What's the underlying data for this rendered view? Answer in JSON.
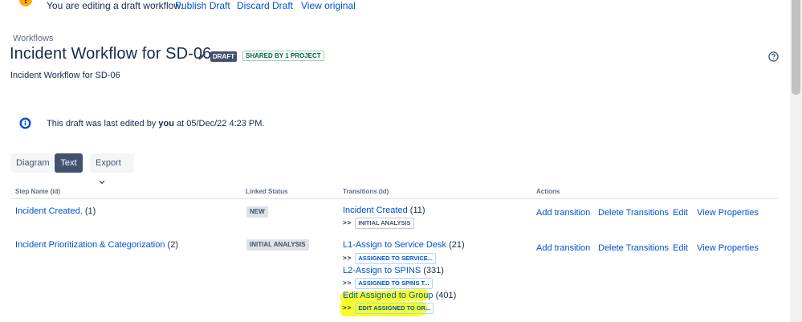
{
  "banner": {
    "icon": "warning-icon",
    "message": "You are editing a draft workflow.",
    "publish_label": "Publish Draft",
    "discard_label": "Discard Draft",
    "view_original_label": "View original"
  },
  "header": {
    "breadcrumb": "Workflows",
    "title": "Incident Workflow for SD-06",
    "draft_lozenge": "DRAFT",
    "shared_lozenge": "SHARED BY 1 PROJECT",
    "subtitle": "Incident Workflow for SD-06"
  },
  "info": {
    "prefix": "This draft was last edited by ",
    "user": "you",
    "suffix": " at 05/Dec/22 4:23 PM."
  },
  "view_toggle": {
    "diagram_label": "Diagram",
    "text_label": "Text",
    "export_label": "Export"
  },
  "table": {
    "headers": {
      "step_name": "Step Name (id)",
      "linked_status": "Linked Status",
      "transitions": "Transitions (id)",
      "actions": "Actions"
    },
    "arrow": ">>",
    "rows": [
      {
        "step_name": "Incident Created.",
        "step_id": "(1)",
        "status": "NEW",
        "transitions": [
          {
            "name": "Incident Created",
            "id": "(11)",
            "target": "INITIAL ANALYSIS"
          }
        ],
        "actions": [
          "Add transition",
          "Delete Transitions",
          "Edit",
          "View Properties"
        ]
      },
      {
        "step_name": "Incident Prioritization & Categorization",
        "step_id": "(2)",
        "status": "INITIAL ANALYSIS",
        "transitions": [
          {
            "name": "L1-Assign to Service Desk",
            "id": "(21)",
            "target": "ASSIGNED TO SERVICE..."
          },
          {
            "name": "L2-Assign to SPINS",
            "id": "(331)",
            "target": "ASSIGNED TO SPINS T..."
          },
          {
            "name": "Edit Assigned to Group",
            "id": "(401)",
            "target": "EDIT ASSIGNED TO GR..."
          }
        ],
        "actions": [
          "Add transition",
          "Delete Transitions",
          "Edit",
          "View Properties"
        ]
      }
    ]
  },
  "colors": {
    "link": "#0052cc",
    "text": "#172b4d",
    "highlight": "#f5ff1a",
    "warning": "#ffab00",
    "info": "#0052cc"
  }
}
